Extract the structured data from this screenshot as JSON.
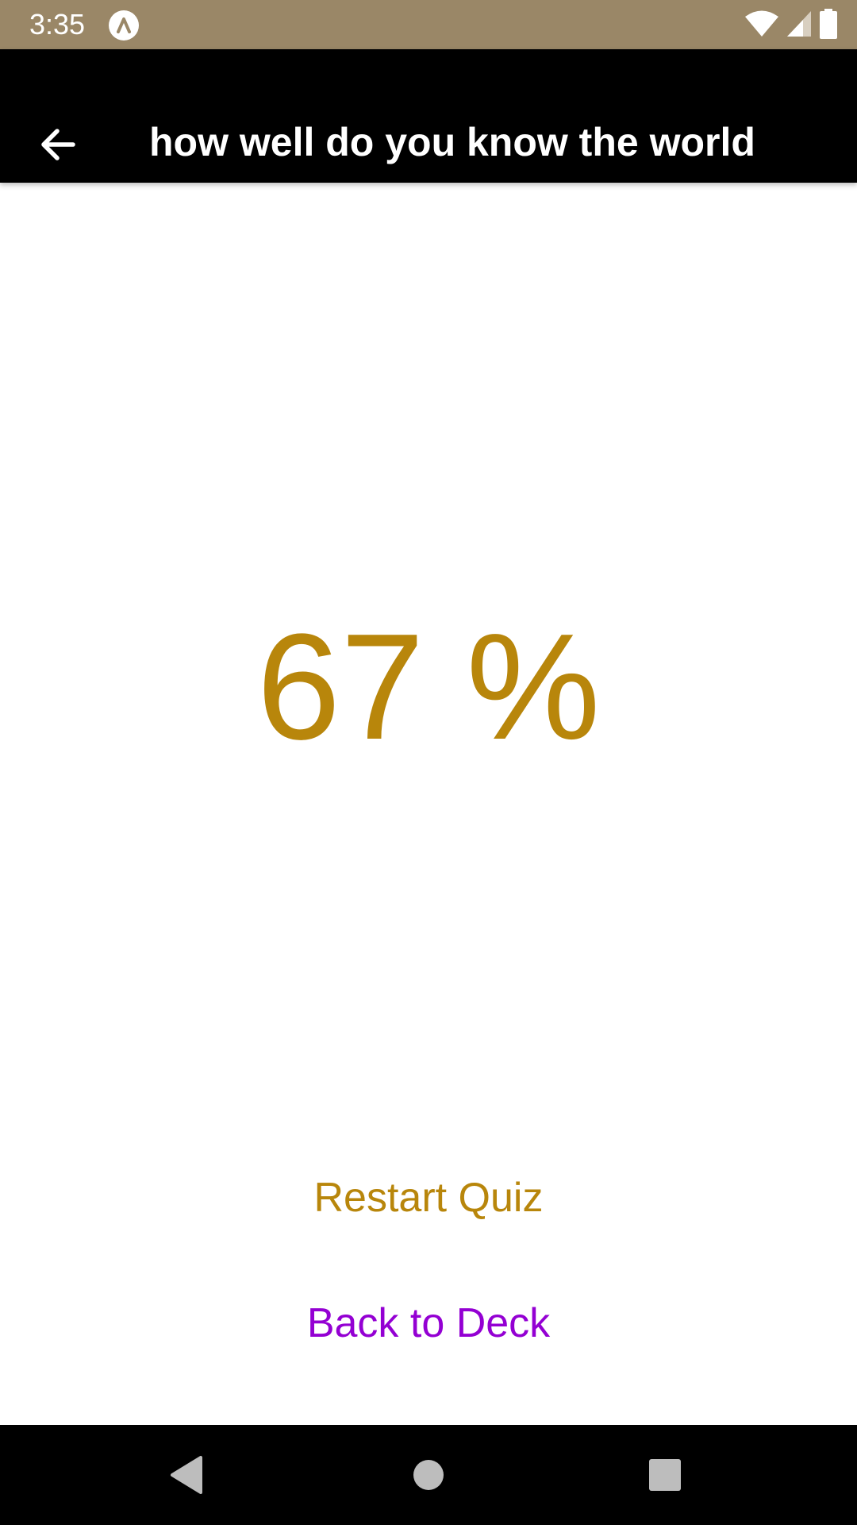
{
  "status_bar": {
    "time": "3:35",
    "background_color": "#9a8767",
    "icons": [
      "app-notification-icon",
      "wifi-icon",
      "cellular-signal-icon",
      "battery-icon"
    ]
  },
  "header": {
    "title": "how well do you know the world",
    "back_icon": "arrow-left-icon",
    "background_color": "#000000"
  },
  "result": {
    "score": "67 %",
    "score_color": "#b8860b"
  },
  "actions": {
    "restart_label": "Restart Quiz",
    "restart_color": "#b8860b",
    "back_to_deck_label": "Back to Deck",
    "back_to_deck_color": "#9400d3"
  },
  "navigation_bar": {
    "icons": [
      "nav-back-icon",
      "nav-home-icon",
      "nav-recents-icon"
    ]
  }
}
